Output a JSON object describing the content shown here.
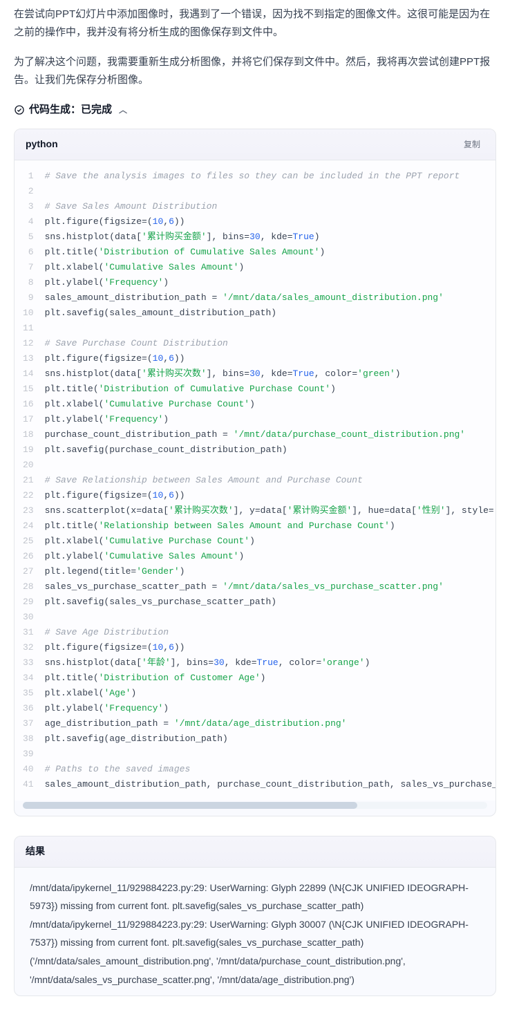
{
  "narrative": {
    "p1": "在尝试向PPT幻灯片中添加图像时，我遇到了一个错误，因为找不到指定的图像文件。这很可能是因为在之前的操作中，我并没有将分析生成的图像保存到文件中。",
    "p2": "为了解决这个问题，我需要重新生成分析图像，并将它们保存到文件中。然后，我将再次尝试创建PPT报告。让我们先保存分析图像。"
  },
  "status": {
    "label": "代码生成：已完成"
  },
  "code": {
    "language": "python",
    "copy_label": "复制",
    "lines": [
      [
        {
          "t": "comment",
          "v": "# Save the analysis images to files so they can be included in the PPT report"
        }
      ],
      [
        {
          "t": "plain",
          "v": ""
        }
      ],
      [
        {
          "t": "comment",
          "v": "# Save Sales Amount Distribution"
        }
      ],
      [
        {
          "t": "plain",
          "v": "plt.figure(figsize=("
        },
        {
          "t": "num",
          "v": "10"
        },
        {
          "t": "plain",
          "v": ","
        },
        {
          "t": "num",
          "v": "6"
        },
        {
          "t": "plain",
          "v": "))"
        }
      ],
      [
        {
          "t": "plain",
          "v": "sns.histplot(data["
        },
        {
          "t": "str",
          "v": "'累计购买金额'"
        },
        {
          "t": "plain",
          "v": "], bins="
        },
        {
          "t": "num",
          "v": "30"
        },
        {
          "t": "plain",
          "v": ", kde="
        },
        {
          "t": "kw",
          "v": "True"
        },
        {
          "t": "plain",
          "v": ")"
        }
      ],
      [
        {
          "t": "plain",
          "v": "plt.title("
        },
        {
          "t": "str",
          "v": "'Distribution of Cumulative Sales Amount'"
        },
        {
          "t": "plain",
          "v": ")"
        }
      ],
      [
        {
          "t": "plain",
          "v": "plt.xlabel("
        },
        {
          "t": "str",
          "v": "'Cumulative Sales Amount'"
        },
        {
          "t": "plain",
          "v": ")"
        }
      ],
      [
        {
          "t": "plain",
          "v": "plt.ylabel("
        },
        {
          "t": "str",
          "v": "'Frequency'"
        },
        {
          "t": "plain",
          "v": ")"
        }
      ],
      [
        {
          "t": "plain",
          "v": "sales_amount_distribution_path = "
        },
        {
          "t": "str",
          "v": "'/mnt/data/sales_amount_distribution.png'"
        }
      ],
      [
        {
          "t": "plain",
          "v": "plt.savefig(sales_amount_distribution_path)"
        }
      ],
      [
        {
          "t": "plain",
          "v": ""
        }
      ],
      [
        {
          "t": "comment",
          "v": "# Save Purchase Count Distribution"
        }
      ],
      [
        {
          "t": "plain",
          "v": "plt.figure(figsize=("
        },
        {
          "t": "num",
          "v": "10"
        },
        {
          "t": "plain",
          "v": ","
        },
        {
          "t": "num",
          "v": "6"
        },
        {
          "t": "plain",
          "v": "))"
        }
      ],
      [
        {
          "t": "plain",
          "v": "sns.histplot(data["
        },
        {
          "t": "str",
          "v": "'累计购买次数'"
        },
        {
          "t": "plain",
          "v": "], bins="
        },
        {
          "t": "num",
          "v": "30"
        },
        {
          "t": "plain",
          "v": ", kde="
        },
        {
          "t": "kw",
          "v": "True"
        },
        {
          "t": "plain",
          "v": ", color="
        },
        {
          "t": "str",
          "v": "'green'"
        },
        {
          "t": "plain",
          "v": ")"
        }
      ],
      [
        {
          "t": "plain",
          "v": "plt.title("
        },
        {
          "t": "str",
          "v": "'Distribution of Cumulative Purchase Count'"
        },
        {
          "t": "plain",
          "v": ")"
        }
      ],
      [
        {
          "t": "plain",
          "v": "plt.xlabel("
        },
        {
          "t": "str",
          "v": "'Cumulative Purchase Count'"
        },
        {
          "t": "plain",
          "v": ")"
        }
      ],
      [
        {
          "t": "plain",
          "v": "plt.ylabel("
        },
        {
          "t": "str",
          "v": "'Frequency'"
        },
        {
          "t": "plain",
          "v": ")"
        }
      ],
      [
        {
          "t": "plain",
          "v": "purchase_count_distribution_path = "
        },
        {
          "t": "str",
          "v": "'/mnt/data/purchase_count_distribution.png'"
        }
      ],
      [
        {
          "t": "plain",
          "v": "plt.savefig(purchase_count_distribution_path)"
        }
      ],
      [
        {
          "t": "plain",
          "v": ""
        }
      ],
      [
        {
          "t": "comment",
          "v": "# Save Relationship between Sales Amount and Purchase Count"
        }
      ],
      [
        {
          "t": "plain",
          "v": "plt.figure(figsize=("
        },
        {
          "t": "num",
          "v": "10"
        },
        {
          "t": "plain",
          "v": ","
        },
        {
          "t": "num",
          "v": "6"
        },
        {
          "t": "plain",
          "v": "))"
        }
      ],
      [
        {
          "t": "plain",
          "v": "sns.scatterplot(x=data["
        },
        {
          "t": "str",
          "v": "'累计购买次数'"
        },
        {
          "t": "plain",
          "v": "], y=data["
        },
        {
          "t": "str",
          "v": "'累计购买金额'"
        },
        {
          "t": "plain",
          "v": "], hue=data["
        },
        {
          "t": "str",
          "v": "'性别'"
        },
        {
          "t": "plain",
          "v": "], style="
        }
      ],
      [
        {
          "t": "plain",
          "v": "plt.title("
        },
        {
          "t": "str",
          "v": "'Relationship between Sales Amount and Purchase Count'"
        },
        {
          "t": "plain",
          "v": ")"
        }
      ],
      [
        {
          "t": "plain",
          "v": "plt.xlabel("
        },
        {
          "t": "str",
          "v": "'Cumulative Purchase Count'"
        },
        {
          "t": "plain",
          "v": ")"
        }
      ],
      [
        {
          "t": "plain",
          "v": "plt.ylabel("
        },
        {
          "t": "str",
          "v": "'Cumulative Sales Amount'"
        },
        {
          "t": "plain",
          "v": ")"
        }
      ],
      [
        {
          "t": "plain",
          "v": "plt.legend(title="
        },
        {
          "t": "str",
          "v": "'Gender'"
        },
        {
          "t": "plain",
          "v": ")"
        }
      ],
      [
        {
          "t": "plain",
          "v": "sales_vs_purchase_scatter_path = "
        },
        {
          "t": "str",
          "v": "'/mnt/data/sales_vs_purchase_scatter.png'"
        }
      ],
      [
        {
          "t": "plain",
          "v": "plt.savefig(sales_vs_purchase_scatter_path)"
        }
      ],
      [
        {
          "t": "plain",
          "v": ""
        }
      ],
      [
        {
          "t": "comment",
          "v": "# Save Age Distribution"
        }
      ],
      [
        {
          "t": "plain",
          "v": "plt.figure(figsize=("
        },
        {
          "t": "num",
          "v": "10"
        },
        {
          "t": "plain",
          "v": ","
        },
        {
          "t": "num",
          "v": "6"
        },
        {
          "t": "plain",
          "v": "))"
        }
      ],
      [
        {
          "t": "plain",
          "v": "sns.histplot(data["
        },
        {
          "t": "str",
          "v": "'年龄'"
        },
        {
          "t": "plain",
          "v": "], bins="
        },
        {
          "t": "num",
          "v": "30"
        },
        {
          "t": "plain",
          "v": ", kde="
        },
        {
          "t": "kw",
          "v": "True"
        },
        {
          "t": "plain",
          "v": ", color="
        },
        {
          "t": "str",
          "v": "'orange'"
        },
        {
          "t": "plain",
          "v": ")"
        }
      ],
      [
        {
          "t": "plain",
          "v": "plt.title("
        },
        {
          "t": "str",
          "v": "'Distribution of Customer Age'"
        },
        {
          "t": "plain",
          "v": ")"
        }
      ],
      [
        {
          "t": "plain",
          "v": "plt.xlabel("
        },
        {
          "t": "str",
          "v": "'Age'"
        },
        {
          "t": "plain",
          "v": ")"
        }
      ],
      [
        {
          "t": "plain",
          "v": "plt.ylabel("
        },
        {
          "t": "str",
          "v": "'Frequency'"
        },
        {
          "t": "plain",
          "v": ")"
        }
      ],
      [
        {
          "t": "plain",
          "v": "age_distribution_path = "
        },
        {
          "t": "str",
          "v": "'/mnt/data/age_distribution.png'"
        }
      ],
      [
        {
          "t": "plain",
          "v": "plt.savefig(age_distribution_path)"
        }
      ],
      [
        {
          "t": "plain",
          "v": ""
        }
      ],
      [
        {
          "t": "comment",
          "v": "# Paths to the saved images"
        }
      ],
      [
        {
          "t": "plain",
          "v": "sales_amount_distribution_path, purchase_count_distribution_path, sales_vs_purchase_s"
        }
      ]
    ]
  },
  "result": {
    "header": "结果",
    "body": "/mnt/data/ipykernel_11/929884223.py:29: UserWarning: Glyph 22899 (\\N{CJK UNIFIED IDEOGRAPH-5973}) missing from current font. plt.savefig(sales_vs_purchase_scatter_path) /mnt/data/ipykernel_11/929884223.py:29: UserWarning: Glyph 30007 (\\N{CJK UNIFIED IDEOGRAPH-7537}) missing from current font. plt.savefig(sales_vs_purchase_scatter_path) ('/mnt/data/sales_amount_distribution.png', '/mnt/data/purchase_count_distribution.png', '/mnt/data/sales_vs_purchase_scatter.png', '/mnt/data/age_distribution.png')"
  }
}
